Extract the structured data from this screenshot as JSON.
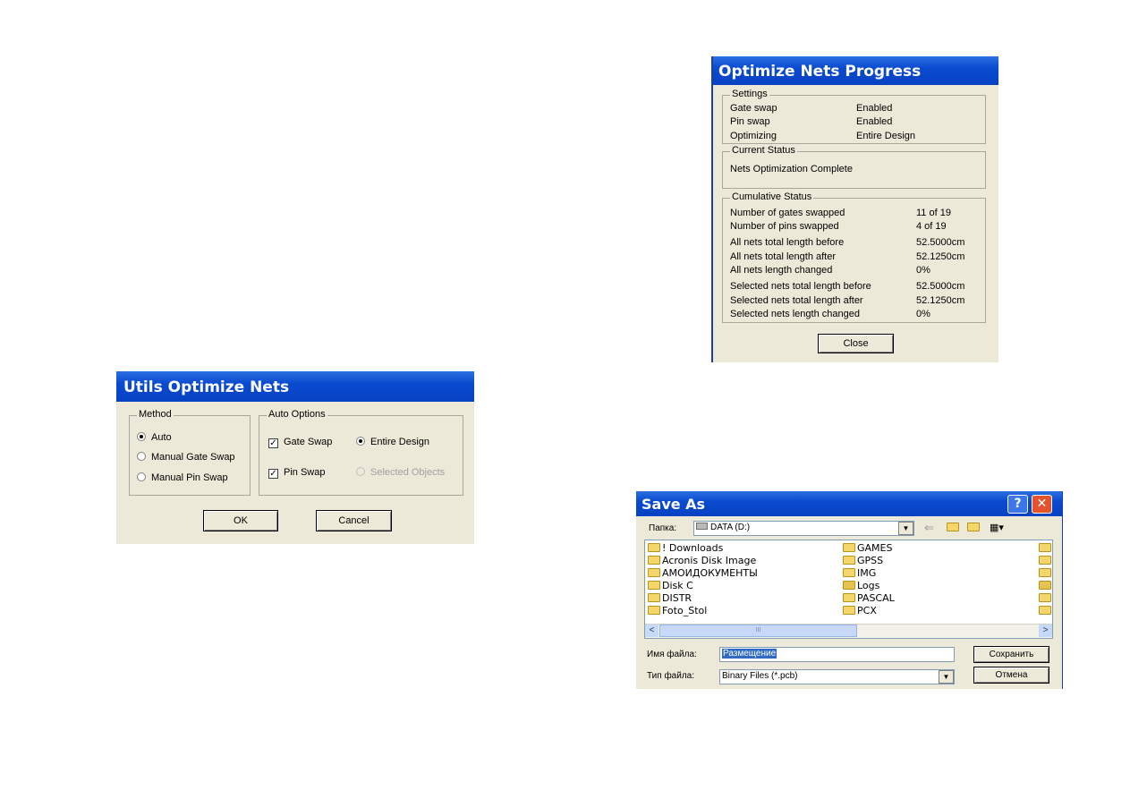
{
  "utils_dialog": {
    "title": "Utils Optimize Nets",
    "method_legend": "Method",
    "methods": [
      "Auto",
      "Manual Gate Swap",
      "Manual Pin Swap"
    ],
    "selected_method": "Auto",
    "auto_options_legend": "Auto Options",
    "gate_swap_label": "Gate Swap",
    "gate_swap_checked": true,
    "pin_swap_label": "Pin Swap",
    "pin_swap_checked": true,
    "entire_design_label": "Entire Design",
    "selected_objects_label": "Selected Objects",
    "ok_label": "OK",
    "cancel_label": "Cancel"
  },
  "progress_dialog": {
    "title": "Optimize Nets Progress",
    "settings_legend": "Settings",
    "settings": [
      {
        "label": "Gate swap",
        "value": "Enabled"
      },
      {
        "label": "Pin swap",
        "value": "Enabled"
      },
      {
        "label": "Optimizing",
        "value": "Entire Design"
      }
    ],
    "current_status_legend": "Current Status",
    "current_status": "Nets Optimization Complete",
    "cumulative_legend": "Cumulative Status",
    "cumulative": [
      {
        "label": "Number of gates swapped",
        "value": "11 of 19"
      },
      {
        "label": "Number of pins swapped",
        "value": "4 of 19"
      },
      {
        "label": "All nets total length before",
        "value": "52.5000cm"
      },
      {
        "label": "All nets total length after",
        "value": "52.1250cm"
      },
      {
        "label": "All nets length changed",
        "value": "0%"
      },
      {
        "label": "Selected nets total length before",
        "value": "52.5000cm"
      },
      {
        "label": "Selected nets total length after",
        "value": "52.1250cm"
      },
      {
        "label": "Selected nets length changed",
        "value": "0%"
      }
    ],
    "close_label": "Close"
  },
  "save_dialog": {
    "title": "Save As",
    "help_glyph": "?",
    "close_glyph": "✕",
    "folder_label": "Папка:",
    "folder_value": "DATA (D:)",
    "files_col1": [
      "! Downloads",
      "Acronis Disk Image",
      "АМОИДОКУМЕНТЫ",
      "Disk C",
      "DISTR",
      "Foto_Stol"
    ],
    "files_col2": [
      "GAMES",
      "GPSS",
      "IMG",
      "Logs",
      "PASCAL",
      "PCX"
    ],
    "filename_label": "Имя файла:",
    "filename_value": "Размещение",
    "filetype_label": "Тип файла:",
    "filetype_value": "Binary Files (*.pcb)",
    "save_label": "Сохранить",
    "cancel_label": "Отмена",
    "scrollbar_thumb": "III",
    "arrow_left": "<",
    "arrow_right": ">",
    "icons": [
      "back-arrow-icon",
      "folder-up-icon",
      "new-folder-icon",
      "view-menu-icon"
    ]
  }
}
